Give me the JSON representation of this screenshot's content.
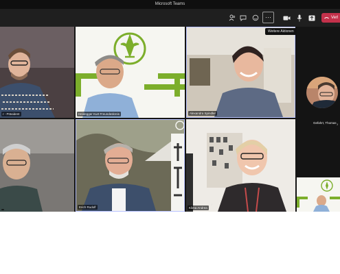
{
  "window": {
    "title": "Microsoft Teams"
  },
  "toolbar": {
    "buttons": [
      {
        "icon": "participants-icon",
        "glyph": "⚇"
      },
      {
        "icon": "chat-icon",
        "glyph": "✉"
      },
      {
        "icon": "reactions-icon",
        "glyph": "☺"
      },
      {
        "icon": "more-actions-icon",
        "glyph": "⋯"
      },
      {
        "icon": "camera-icon",
        "glyph": "■"
      },
      {
        "icon": "microphone-icon",
        "glyph": "♪"
      },
      {
        "icon": "share-icon",
        "glyph": "⬆"
      }
    ],
    "leave_label": "Verl",
    "tooltip": "Weitere Aktionen"
  },
  "participants": [
    {
      "name": "r - Präsident"
    },
    {
      "name": "Heidegger Kurt Freundeskreis"
    },
    {
      "name": "Alexandra Spindler"
    },
    {
      "name": ""
    },
    {
      "name": "Erich Rudolf"
    },
    {
      "name": "Klima Andrea"
    }
  ],
  "side": {
    "name": "Gefahrt, Thomas"
  },
  "colors": {
    "accent": "#6264a7",
    "leave": "#c4314b",
    "logo_green": "#7cae2b"
  }
}
